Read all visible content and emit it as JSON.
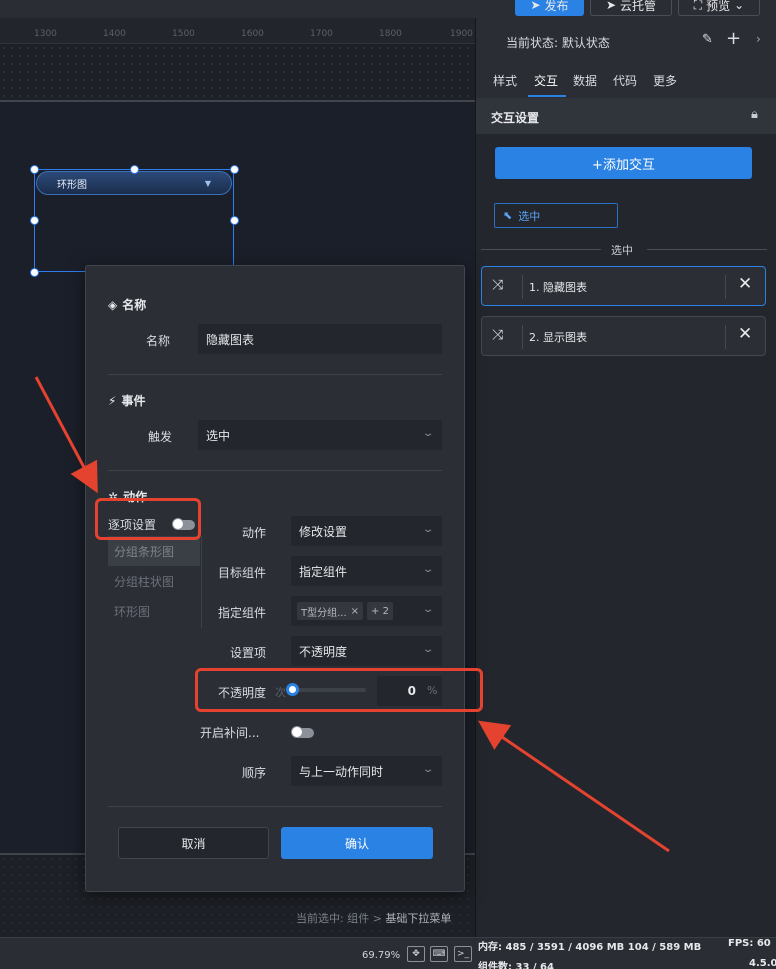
{
  "toolbar": {
    "publish_label": "发布",
    "cloud_label": "云托管",
    "preview_label": "预览"
  },
  "ruler": {
    "ticks": [
      "1300",
      "1400",
      "1500",
      "1600",
      "1700",
      "1800",
      "1900"
    ]
  },
  "canvas": {
    "widget_label": "环形图",
    "current_selection_prefix": "当前选中: 组件 > ",
    "current_selection_value": "基础下拉菜单"
  },
  "statusbar": {
    "zoom": "69.79%",
    "memory": "内存: 485 / 3591 / 4096 MB  104 / 589 MB",
    "fps": "FPS: 60",
    "component_count": "组件数: 33 / 64",
    "version": "4.5.0"
  },
  "right_panel": {
    "state_label": "当前状态:  默认状态",
    "tabs": [
      {
        "label": "样式"
      },
      {
        "label": "交互"
      },
      {
        "label": "数据"
      },
      {
        "label": "代码"
      },
      {
        "label": "更多"
      }
    ],
    "section_title": "交互设置",
    "add_button_label": "+添加交互",
    "event_chip_label": "选中",
    "divider_label": "选中",
    "actions": [
      {
        "label": "1. 隐藏图表"
      },
      {
        "label": "2. 显示图表"
      }
    ]
  },
  "modal": {
    "name_section": "名称",
    "name_label": "名称",
    "name_value": "隐藏图表",
    "event_section": "事件",
    "trigger_label": "触发",
    "trigger_value": "选中",
    "action_section": "动作",
    "per_item_label": "逐项设置",
    "side_items": [
      {
        "label": "分组条形图"
      },
      {
        "label": "分组柱状图"
      },
      {
        "label": "环形图"
      }
    ],
    "action_label": "动作",
    "action_value": "修改设置",
    "target_label": "目标组件",
    "target_value": "指定组件",
    "specified_label": "指定组件",
    "specified_tag": "T型分组...",
    "specified_more": "+ 2",
    "setting_label": "设置项",
    "setting_value": "不透明度",
    "opacity_label": "不透明度",
    "opacity_glyph": "次",
    "opacity_value": "0",
    "opacity_unit": "%",
    "opacity_level": 0,
    "tween_label": "开启补间...",
    "order_label": "顺序",
    "order_value": "与上一动作同时",
    "cancel_label": "取消",
    "ok_label": "确认"
  }
}
